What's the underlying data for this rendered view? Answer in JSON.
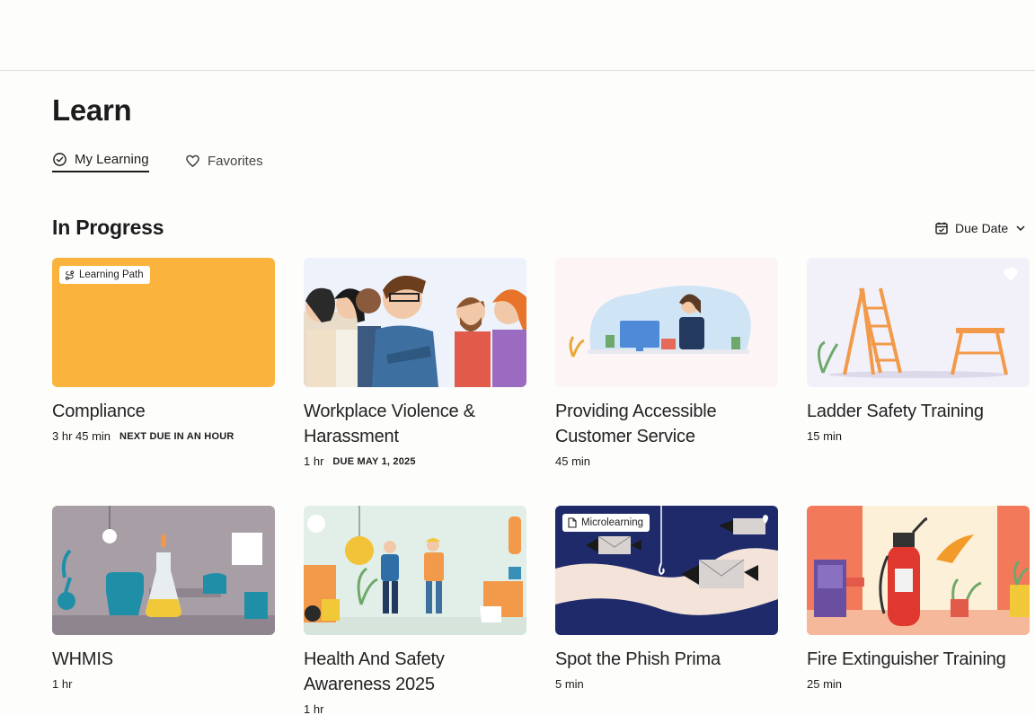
{
  "page": {
    "title": "Learn"
  },
  "tabs": [
    {
      "label": "My Learning",
      "icon": "check-circle-icon",
      "active": true
    },
    {
      "label": "Favorites",
      "icon": "heart-icon",
      "active": false
    }
  ],
  "section": {
    "title": "In Progress",
    "sort_label": "Due Date",
    "sort_icon": "calendar-icon"
  },
  "colors": {
    "compliance_bg": "#fab43e",
    "tab_underline": "#1c1c1c"
  },
  "cards": [
    {
      "title": "Compliance",
      "duration": "3 hr 45 min",
      "due": "NEXT DUE IN AN HOUR",
      "badge": "Learning Path"
    },
    {
      "title": "Workplace Violence & Harassment",
      "duration": "1 hr",
      "due": "DUE MAY 1, 2025"
    },
    {
      "title": "Providing Accessible Customer Service",
      "duration": "45 min"
    },
    {
      "title": "Ladder Safety Training",
      "duration": "15 min"
    },
    {
      "title": "WHMIS",
      "duration": "1 hr"
    },
    {
      "title": "Health And Safety Awareness 2025",
      "duration": "1 hr"
    },
    {
      "title": "Spot the Phish Prima",
      "duration": "5 min",
      "badge": "Microlearning"
    },
    {
      "title": "Fire Extinguisher Training",
      "duration": "25 min"
    }
  ]
}
